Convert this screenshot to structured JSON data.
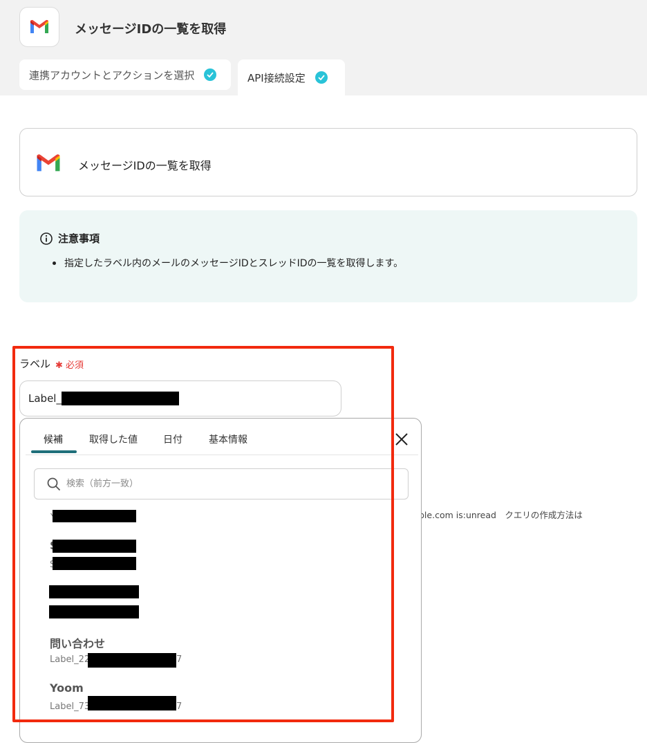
{
  "header": {
    "title": "メッセージIDの一覧を取得",
    "tabs": [
      {
        "label": "連携アカウントとアクションを選択",
        "completed": true
      },
      {
        "label": "API接続設定",
        "completed": true
      }
    ]
  },
  "action_card": {
    "label": "メッセージIDの一覧を取得",
    "icon": "gmail-icon"
  },
  "notice": {
    "title": "注意事項",
    "items": [
      "指定したラベル内のメールのメッセージIDとスレッドIDの一覧を取得します。"
    ]
  },
  "field": {
    "label": "ラベル",
    "required_label": "必須",
    "value_prefix": "Label_"
  },
  "background_hint": "ple.com is:unread　クエリの作成方法は",
  "dropdown": {
    "tabs": [
      "候補",
      "取得した値",
      "日付",
      "基本情報"
    ],
    "active_tab": "候補",
    "search_placeholder": "検索（前方一致）",
    "items": [
      {
        "title": "",
        "subtitle": "Y"
      },
      {
        "title": "S",
        "subtitle": "S"
      },
      {
        "title": "",
        "subtitle": ""
      },
      {
        "title": "問い合わせ",
        "subtitle_prefix": "Label_22",
        "subtitle_suffix": "7"
      },
      {
        "title": "Yoom",
        "subtitle_prefix": "Label_73",
        "subtitle_suffix": "7"
      }
    ]
  },
  "colors": {
    "accent": "#29c3d8",
    "highlight": "#f22a0e",
    "tab_underline": "#1f6f7a",
    "notice_bg": "#eef7f6"
  }
}
